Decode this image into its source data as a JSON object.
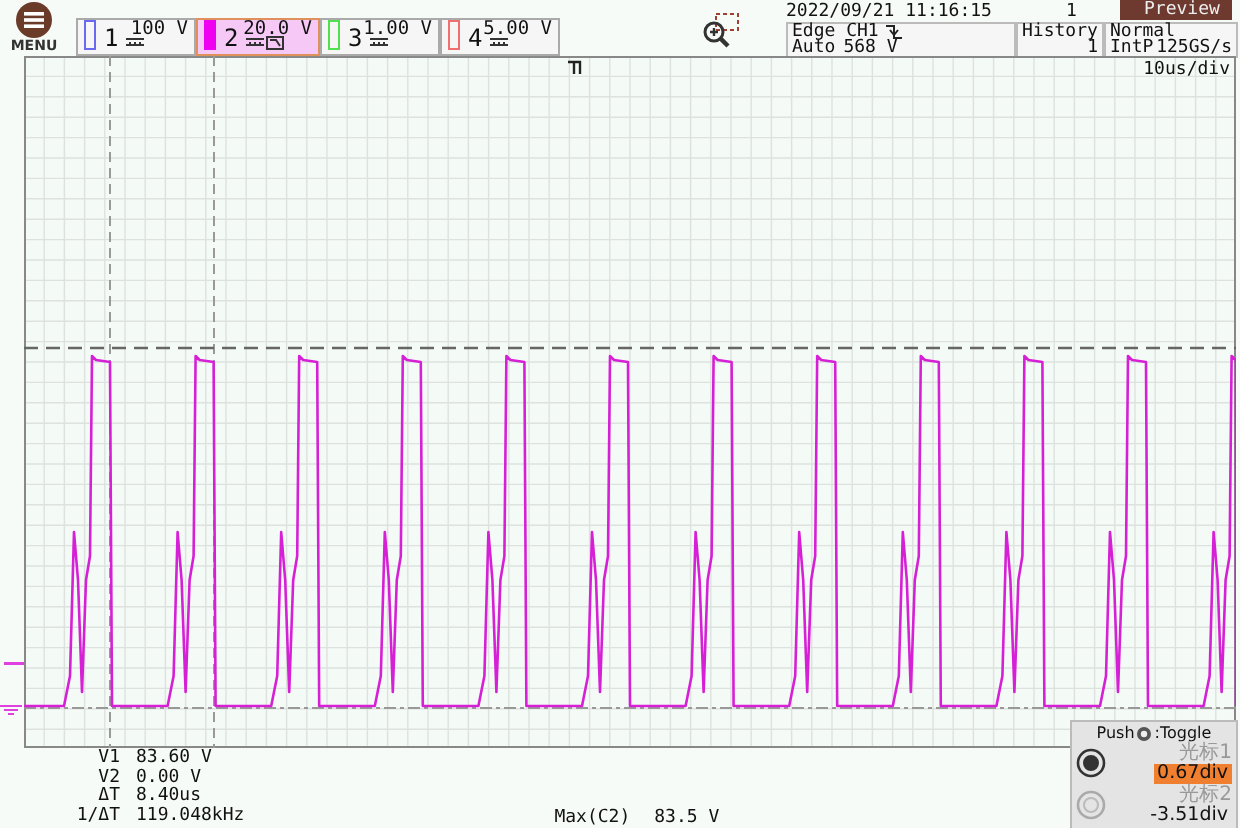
{
  "menu": {
    "label": "MENU"
  },
  "channels": [
    {
      "number": "1",
      "scale": "100 V",
      "selected": false,
      "color": "#6a6af0",
      "bw_limit": false
    },
    {
      "number": "2",
      "scale": "20.0 V",
      "selected": true,
      "color": "#f000f0",
      "bw_limit": true
    },
    {
      "number": "3",
      "scale": "1.00 V",
      "selected": false,
      "color": "#50e050",
      "bw_limit": false
    },
    {
      "number": "4",
      "scale": "5.00 V",
      "selected": false,
      "color": "#f07070",
      "bw_limit": false
    }
  ],
  "datetime": "2022/09/21 11:16:15",
  "acquisition_count": "1",
  "mode_badge": "Preview",
  "trigger": {
    "type": "Edge CH1",
    "mode": "Auto",
    "level": "568 V"
  },
  "history": {
    "label": "History",
    "value": "1"
  },
  "acquire": {
    "mode": "Normal",
    "interp": "IntP",
    "rate": "125GS/s"
  },
  "timebase": "10us/div",
  "readouts": [
    {
      "label": "V1",
      "value": "83.60 V"
    },
    {
      "label": "V2",
      "value": "0.00 V"
    },
    {
      "label": "ΔT",
      "value": "8.40us"
    },
    {
      "label": "1/ΔT",
      "value": "119.048kHz"
    }
  ],
  "measurement": {
    "label": "Max(C2)",
    "value": "83.5 V"
  },
  "cursor_panel": {
    "push": "Push",
    "toggle": ":Toggle",
    "cursors": [
      {
        "name": "光标1",
        "value": "0.67div",
        "selected": true
      },
      {
        "name": "光标2",
        "value": "-3.51div",
        "selected": false
      }
    ]
  }
}
